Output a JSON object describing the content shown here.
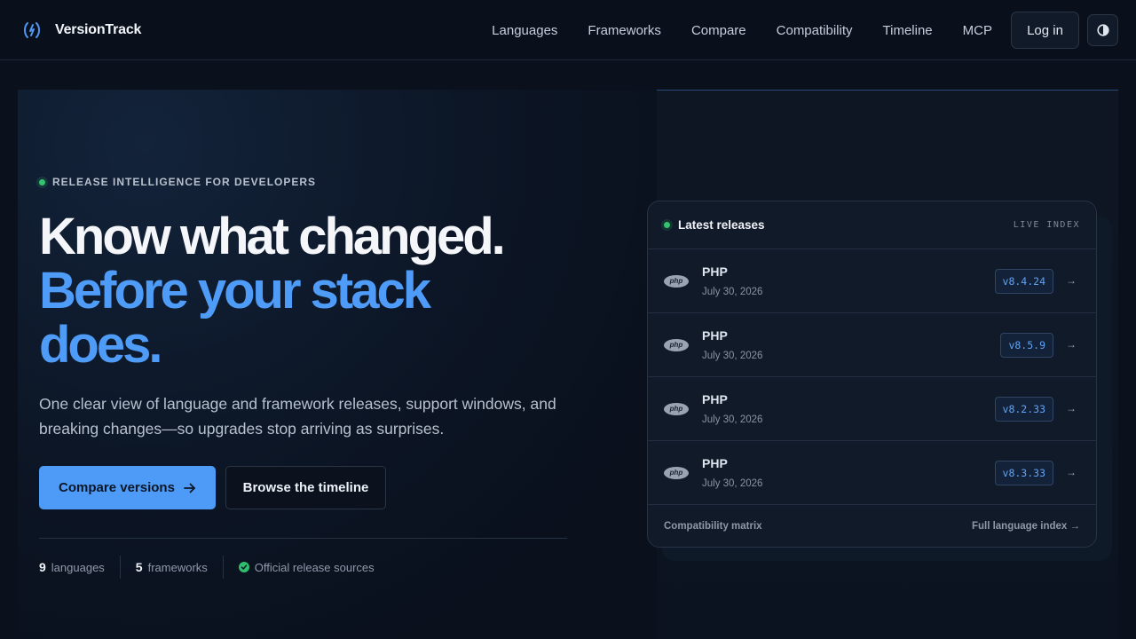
{
  "header": {
    "brand_name": "VersionTrack",
    "nav": [
      "Languages",
      "Frameworks",
      "Compare",
      "Compatibility",
      "Timeline",
      "MCP"
    ],
    "login_label": "Log in"
  },
  "hero": {
    "eyebrow": "RELEASE INTELLIGENCE FOR DEVELOPERS",
    "headline_line1": "Know what changed.",
    "headline_line2": "Before your stack",
    "headline_line3": "does.",
    "subcopy": "One clear view of language and framework releases, support windows, and breaking changes—so upgrades stop arriving as surprises.",
    "primary_cta": "Compare versions",
    "secondary_cta": "Browse the timeline",
    "stats": {
      "languages_count": "9",
      "languages_label": "languages",
      "frameworks_count": "5",
      "frameworks_label": "frameworks",
      "sources_label": "Official release sources"
    }
  },
  "releases": {
    "title": "Latest releases",
    "badge": "LIVE INDEX",
    "items": [
      {
        "name": "PHP",
        "date": "July 30, 2026",
        "version": "v8.4.24"
      },
      {
        "name": "PHP",
        "date": "July 30, 2026",
        "version": "v8.5.9"
      },
      {
        "name": "PHP",
        "date": "July 30, 2026",
        "version": "v8.2.33"
      },
      {
        "name": "PHP",
        "date": "July 30, 2026",
        "version": "v8.3.33"
      }
    ],
    "logo_text": "php",
    "footer_left": "Compatibility matrix",
    "footer_right": "Full language index →"
  },
  "colors": {
    "accent": "#4d9bf7",
    "background": "#0a101c",
    "status_green": "#34c36f"
  }
}
